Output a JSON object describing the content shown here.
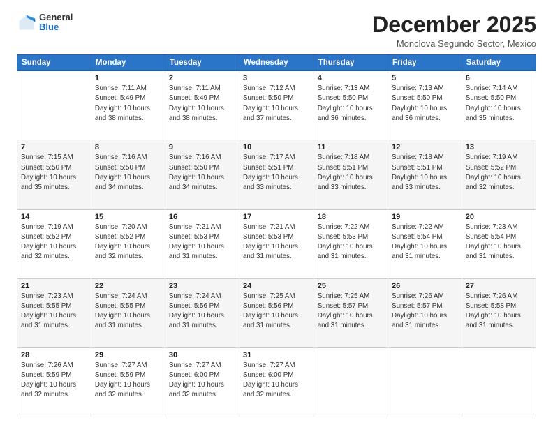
{
  "header": {
    "logo_general": "General",
    "logo_blue": "Blue",
    "title": "December 2025",
    "subtitle": "Monclova Segundo Sector, Mexico"
  },
  "days_of_week": [
    "Sunday",
    "Monday",
    "Tuesday",
    "Wednesday",
    "Thursday",
    "Friday",
    "Saturday"
  ],
  "weeks": [
    [
      {
        "day": "",
        "info": ""
      },
      {
        "day": "1",
        "info": "Sunrise: 7:11 AM\nSunset: 5:49 PM\nDaylight: 10 hours\nand 38 minutes."
      },
      {
        "day": "2",
        "info": "Sunrise: 7:11 AM\nSunset: 5:49 PM\nDaylight: 10 hours\nand 38 minutes."
      },
      {
        "day": "3",
        "info": "Sunrise: 7:12 AM\nSunset: 5:50 PM\nDaylight: 10 hours\nand 37 minutes."
      },
      {
        "day": "4",
        "info": "Sunrise: 7:13 AM\nSunset: 5:50 PM\nDaylight: 10 hours\nand 36 minutes."
      },
      {
        "day": "5",
        "info": "Sunrise: 7:13 AM\nSunset: 5:50 PM\nDaylight: 10 hours\nand 36 minutes."
      },
      {
        "day": "6",
        "info": "Sunrise: 7:14 AM\nSunset: 5:50 PM\nDaylight: 10 hours\nand 35 minutes."
      }
    ],
    [
      {
        "day": "7",
        "info": "Sunrise: 7:15 AM\nSunset: 5:50 PM\nDaylight: 10 hours\nand 35 minutes."
      },
      {
        "day": "8",
        "info": "Sunrise: 7:16 AM\nSunset: 5:50 PM\nDaylight: 10 hours\nand 34 minutes."
      },
      {
        "day": "9",
        "info": "Sunrise: 7:16 AM\nSunset: 5:50 PM\nDaylight: 10 hours\nand 34 minutes."
      },
      {
        "day": "10",
        "info": "Sunrise: 7:17 AM\nSunset: 5:51 PM\nDaylight: 10 hours\nand 33 minutes."
      },
      {
        "day": "11",
        "info": "Sunrise: 7:18 AM\nSunset: 5:51 PM\nDaylight: 10 hours\nand 33 minutes."
      },
      {
        "day": "12",
        "info": "Sunrise: 7:18 AM\nSunset: 5:51 PM\nDaylight: 10 hours\nand 33 minutes."
      },
      {
        "day": "13",
        "info": "Sunrise: 7:19 AM\nSunset: 5:52 PM\nDaylight: 10 hours\nand 32 minutes."
      }
    ],
    [
      {
        "day": "14",
        "info": "Sunrise: 7:19 AM\nSunset: 5:52 PM\nDaylight: 10 hours\nand 32 minutes."
      },
      {
        "day": "15",
        "info": "Sunrise: 7:20 AM\nSunset: 5:52 PM\nDaylight: 10 hours\nand 32 minutes."
      },
      {
        "day": "16",
        "info": "Sunrise: 7:21 AM\nSunset: 5:53 PM\nDaylight: 10 hours\nand 31 minutes."
      },
      {
        "day": "17",
        "info": "Sunrise: 7:21 AM\nSunset: 5:53 PM\nDaylight: 10 hours\nand 31 minutes."
      },
      {
        "day": "18",
        "info": "Sunrise: 7:22 AM\nSunset: 5:53 PM\nDaylight: 10 hours\nand 31 minutes."
      },
      {
        "day": "19",
        "info": "Sunrise: 7:22 AM\nSunset: 5:54 PM\nDaylight: 10 hours\nand 31 minutes."
      },
      {
        "day": "20",
        "info": "Sunrise: 7:23 AM\nSunset: 5:54 PM\nDaylight: 10 hours\nand 31 minutes."
      }
    ],
    [
      {
        "day": "21",
        "info": "Sunrise: 7:23 AM\nSunset: 5:55 PM\nDaylight: 10 hours\nand 31 minutes."
      },
      {
        "day": "22",
        "info": "Sunrise: 7:24 AM\nSunset: 5:55 PM\nDaylight: 10 hours\nand 31 minutes."
      },
      {
        "day": "23",
        "info": "Sunrise: 7:24 AM\nSunset: 5:56 PM\nDaylight: 10 hours\nand 31 minutes."
      },
      {
        "day": "24",
        "info": "Sunrise: 7:25 AM\nSunset: 5:56 PM\nDaylight: 10 hours\nand 31 minutes."
      },
      {
        "day": "25",
        "info": "Sunrise: 7:25 AM\nSunset: 5:57 PM\nDaylight: 10 hours\nand 31 minutes."
      },
      {
        "day": "26",
        "info": "Sunrise: 7:26 AM\nSunset: 5:57 PM\nDaylight: 10 hours\nand 31 minutes."
      },
      {
        "day": "27",
        "info": "Sunrise: 7:26 AM\nSunset: 5:58 PM\nDaylight: 10 hours\nand 31 minutes."
      }
    ],
    [
      {
        "day": "28",
        "info": "Sunrise: 7:26 AM\nSunset: 5:59 PM\nDaylight: 10 hours\nand 32 minutes."
      },
      {
        "day": "29",
        "info": "Sunrise: 7:27 AM\nSunset: 5:59 PM\nDaylight: 10 hours\nand 32 minutes."
      },
      {
        "day": "30",
        "info": "Sunrise: 7:27 AM\nSunset: 6:00 PM\nDaylight: 10 hours\nand 32 minutes."
      },
      {
        "day": "31",
        "info": "Sunrise: 7:27 AM\nSunset: 6:00 PM\nDaylight: 10 hours\nand 32 minutes."
      },
      {
        "day": "",
        "info": ""
      },
      {
        "day": "",
        "info": ""
      },
      {
        "day": "",
        "info": ""
      }
    ]
  ]
}
